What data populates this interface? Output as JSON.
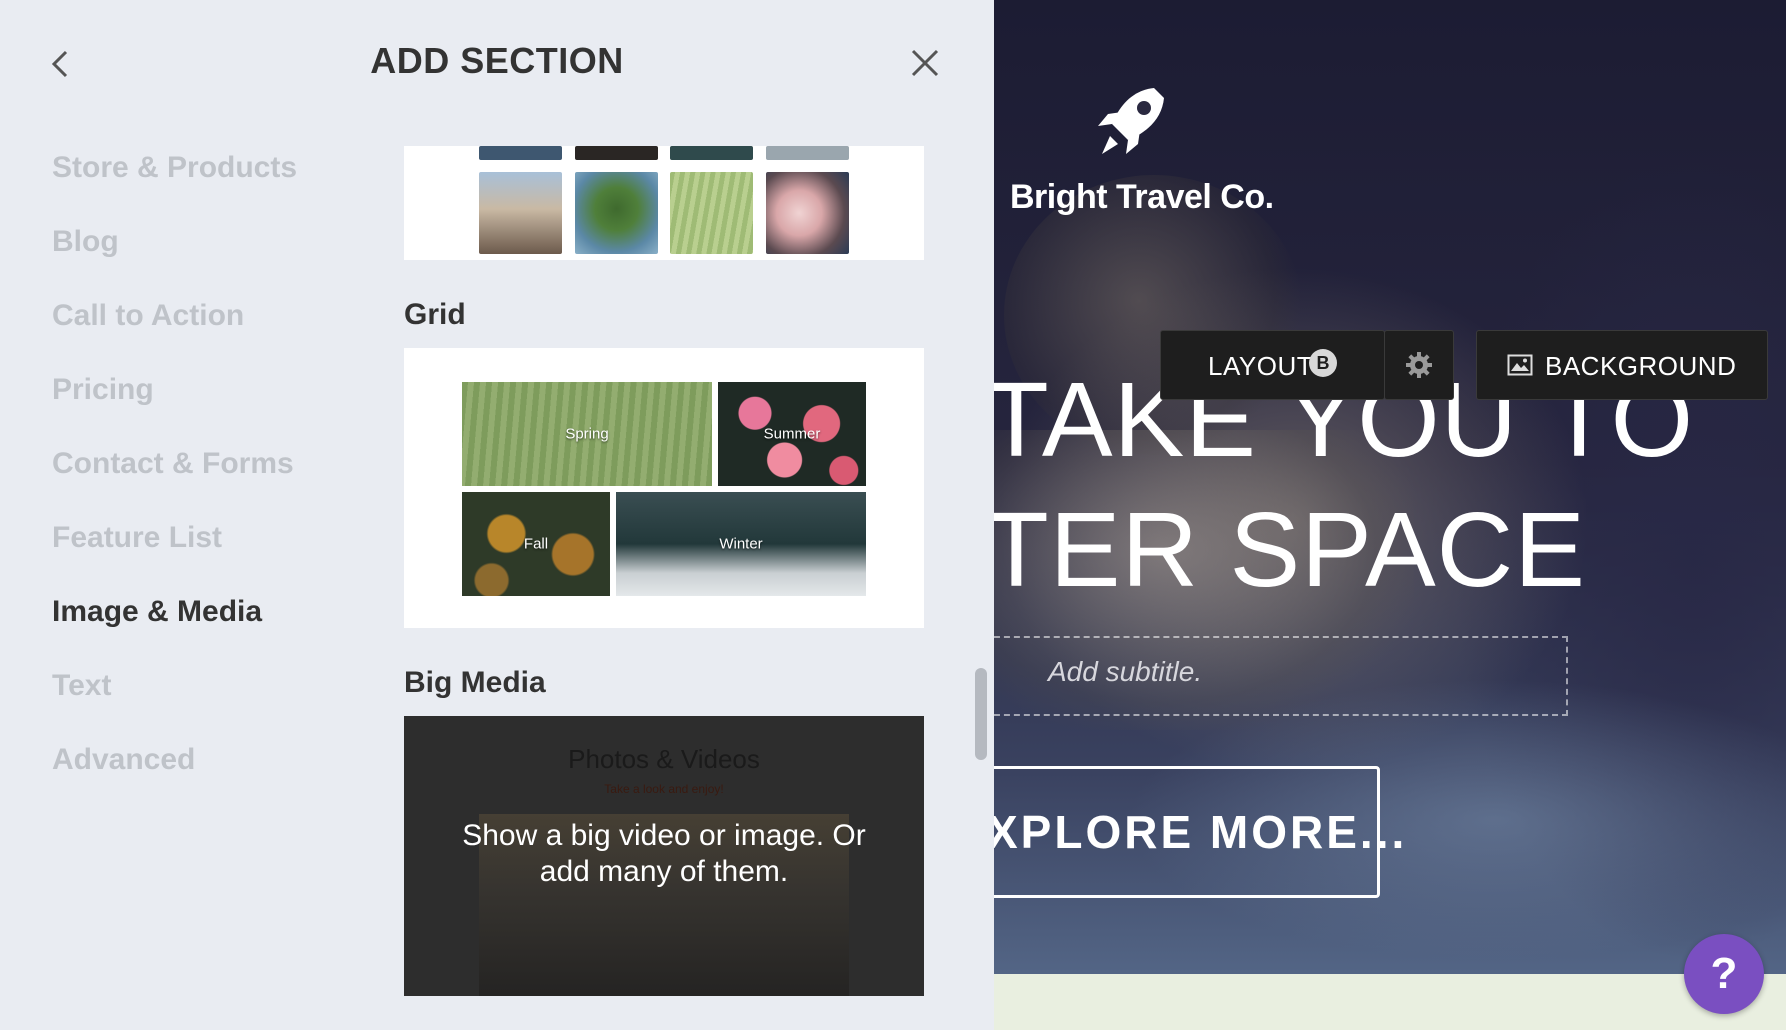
{
  "panel": {
    "title": "ADD SECTION",
    "categories": [
      {
        "label": "Store & Products"
      },
      {
        "label": "Blog"
      },
      {
        "label": "Call to Action"
      },
      {
        "label": "Pricing"
      },
      {
        "label": "Contact & Forms"
      },
      {
        "label": "Feature List"
      },
      {
        "label": "Image & Media",
        "active": true
      },
      {
        "label": "Text"
      },
      {
        "label": "Advanced"
      }
    ],
    "sections": {
      "grid": {
        "label": "Grid",
        "tiles": [
          "Spring",
          "Summer",
          "Fall",
          "Winter"
        ]
      },
      "big_media": {
        "label": "Big Media",
        "preview_title": "Photos & Videos",
        "preview_tagline": "Take a look and enjoy!",
        "description": "Show a big video or image. Or add many of them."
      }
    }
  },
  "site": {
    "brand": "Bright Travel Co.",
    "hero_line_1": "TAKE YOU TO",
    "hero_line_2": "TER SPACE",
    "subtitle_placeholder": "Add subtitle.",
    "cta_label": "XPLORE MORE...",
    "toolbar": {
      "layout_label": "LAYOUT",
      "layout_badge": "B",
      "background_label": "BACKGROUND"
    }
  },
  "help": {
    "label": "?"
  },
  "colors": {
    "accent": "#7a4fc1",
    "panel_bg": "#e9ecf2",
    "toolbar_bg": "#1e1e1e"
  }
}
